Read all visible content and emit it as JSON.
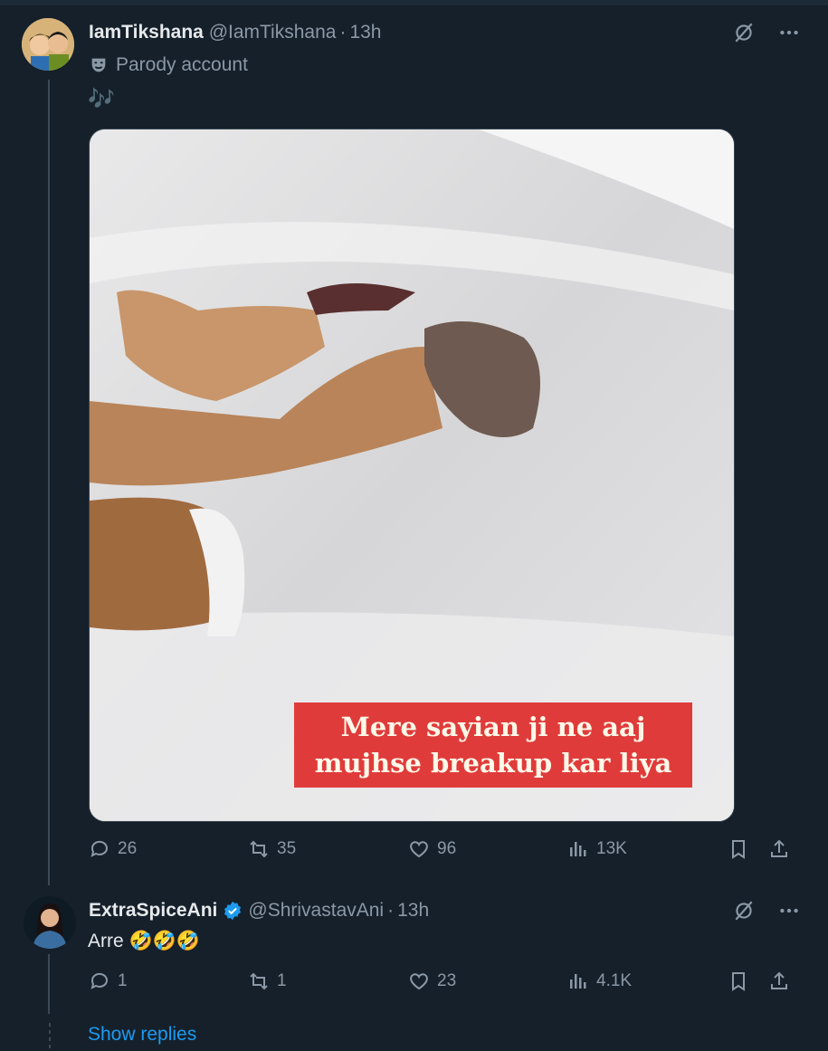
{
  "tweet1": {
    "name": "IamTikshana",
    "handle": "@IamTikshana",
    "time": "13h",
    "badge": "Parody account",
    "text": "🎶",
    "media_caption_line1": "Mere sayian ji ne aaj",
    "media_caption_line2": "mujhse breakup kar liya",
    "replies": "26",
    "retweets": "35",
    "likes": "96",
    "views": "13K"
  },
  "tweet2": {
    "name": "ExtraSpiceAni",
    "handle": "@ShrivastavAni",
    "time": "13h",
    "text": "Arre 🤣🤣🤣",
    "replies": "1",
    "retweets": "1",
    "likes": "23",
    "views": "4.1K"
  },
  "show_replies": "Show replies",
  "colors": {
    "background": "#15202b",
    "accent": "#1d9bf0",
    "muted": "#8b98a5",
    "verified": "#1d9bf0",
    "caption_bg": "#e03b3b"
  }
}
